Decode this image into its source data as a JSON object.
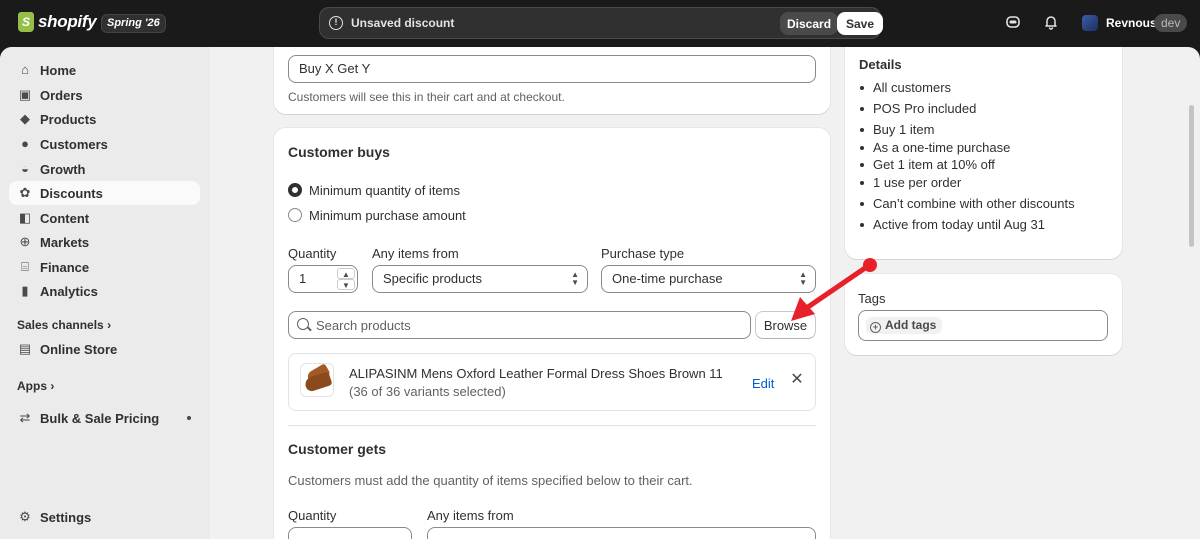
{
  "app": {
    "brand": "shopify",
    "edition_badge": "Spring '26",
    "store_name": "Revnous",
    "store_badge": "dev"
  },
  "contextual_save_bar": {
    "message": "Unsaved discount",
    "discard_label": "Discard",
    "save_label": "Save"
  },
  "sidebar": {
    "items": [
      {
        "label": "Home",
        "icon": "home-icon"
      },
      {
        "label": "Orders",
        "icon": "orders-icon"
      },
      {
        "label": "Products",
        "icon": "tag-icon"
      },
      {
        "label": "Customers",
        "icon": "person-icon"
      },
      {
        "label": "Growth",
        "icon": "growth-icon"
      },
      {
        "label": "Discounts",
        "icon": "discount-icon",
        "active": true
      },
      {
        "label": "Content",
        "icon": "content-icon"
      },
      {
        "label": "Markets",
        "icon": "globe-icon"
      },
      {
        "label": "Finance",
        "icon": "bank-icon"
      },
      {
        "label": "Analytics",
        "icon": "chart-icon"
      }
    ],
    "sales_channels_label": "Sales channels",
    "online_store_label": "Online Store",
    "apps_label": "Apps",
    "app_item_label": "Bulk & Sale Pricing",
    "settings_label": "Settings"
  },
  "title_card": {
    "title_value": "Buy X Get Y",
    "help_text": "Customers will see this in their cart and at checkout."
  },
  "customer_buys": {
    "heading": "Customer buys",
    "options": [
      {
        "label": "Minimum quantity of items",
        "checked": true
      },
      {
        "label": "Minimum purchase amount",
        "checked": false
      }
    ],
    "quantity_label": "Quantity",
    "quantity_value": "1",
    "items_from_label": "Any items from",
    "items_from_value": "Specific products",
    "purchase_type_label": "Purchase type",
    "purchase_type_value": "One-time purchase",
    "search_placeholder": "Search products",
    "browse_label": "Browse",
    "product": {
      "name": "ALIPASINM Mens Oxford Leather Formal Dress Shoes Brown 11",
      "variants": "(36 of 36 variants selected)",
      "edit_label": "Edit"
    }
  },
  "customer_gets": {
    "heading": "Customer gets",
    "help_text": "Customers must add the quantity of items specified below to their cart.",
    "quantity_label": "Quantity",
    "items_from_label": "Any items from"
  },
  "details": {
    "heading": "Details",
    "items": [
      "All customers",
      "POS Pro included",
      "Buy 1 item",
      "As a one-time purchase",
      "Get 1 item at 10% off",
      "1 use per order",
      "Can’t combine with other discounts",
      "Active from today until Aug 31"
    ]
  },
  "tags": {
    "heading": "Tags",
    "add_label": "Add tags"
  },
  "colors": {
    "topbar": "#1a1a1a",
    "accent_link": "#005bd3",
    "annotation_arrow": "#e8202a"
  }
}
